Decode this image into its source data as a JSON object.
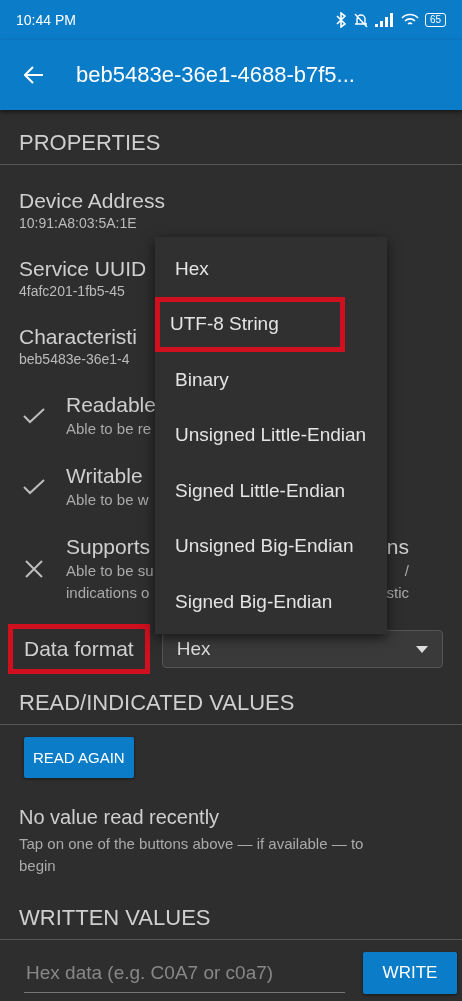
{
  "status_bar": {
    "time": "10:44 PM",
    "battery": "65"
  },
  "app_bar": {
    "title": "beb5483e-36e1-4688-b7f5..."
  },
  "properties": {
    "heading": "PROPERTIES",
    "fields": [
      {
        "label": "Device Address",
        "value": "10:91:A8:03:5A:1E"
      },
      {
        "label": "Service UUID",
        "value": "4fafc201-1fb5-45"
      },
      {
        "label": "Characteristi",
        "value": "beb5483e-36e1-4"
      }
    ],
    "capabilities": [
      {
        "supported": true,
        "title": "Readable",
        "lines": [
          {
            "left": "Able to be re"
          }
        ]
      },
      {
        "supported": true,
        "title": "Writable",
        "lines": [
          {
            "left": "Able to be w"
          }
        ]
      },
      {
        "supported": false,
        "title": "Supports",
        "title_tail": "ns",
        "lines": [
          {
            "left": "Able to be su",
            "right": "/"
          },
          {
            "left": "indications o",
            "right": "stic"
          }
        ]
      }
    ]
  },
  "data_format": {
    "label": "Data format",
    "highlighted": true,
    "value": "Hex"
  },
  "format_menu": [
    {
      "label": "Hex",
      "highlighted": false
    },
    {
      "label": "UTF-8 String",
      "highlighted": true
    },
    {
      "label": "Binary",
      "highlighted": false
    },
    {
      "label": "Unsigned Little-Endian",
      "highlighted": false
    },
    {
      "label": "Signed Little-Endian",
      "highlighted": false
    },
    {
      "label": "Unsigned Big-Endian",
      "highlighted": false
    },
    {
      "label": "Signed Big-Endian",
      "highlighted": false
    }
  ],
  "read_section": {
    "heading": "READ/INDICATED VALUES",
    "button": "READ AGAIN",
    "message": "No value read recently",
    "hint": "Tap on one of the buttons above — if available — to begin"
  },
  "write_section": {
    "heading": "WRITTEN VALUES",
    "placeholder": "Hex data (e.g. C0A7 or c0a7)",
    "button": "WRITE"
  }
}
